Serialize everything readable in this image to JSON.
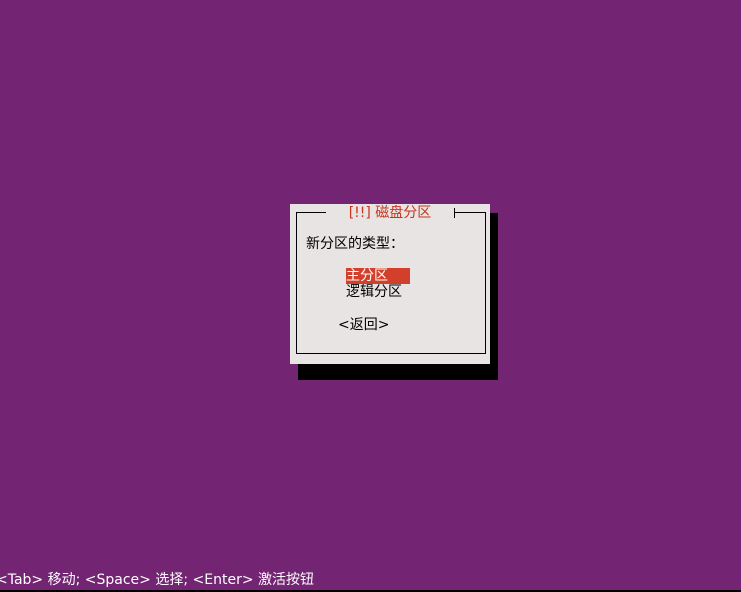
{
  "colors": {
    "desktop_background": "#732472",
    "dialog_background": "#e8e4e4",
    "title_text": "#c8351e",
    "selection_background": "#d23f2a",
    "selection_text": "#ffffff",
    "status_text": "#ffffff"
  },
  "dialog": {
    "title": "[!!] 磁盘分区",
    "question": "新分区的类型：",
    "options": [
      {
        "label": "主分区",
        "selected": true
      },
      {
        "label": "逻辑分区",
        "selected": false
      }
    ],
    "back_label": "<返回>"
  },
  "statusbar": {
    "text": "<Tab> 移动; <Space> 选择; <Enter> 激活按钮"
  }
}
